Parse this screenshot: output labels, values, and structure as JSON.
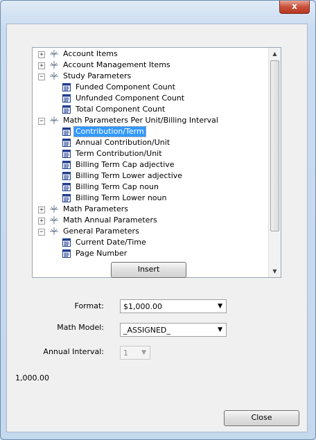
{
  "window": {
    "close_glyph": "x"
  },
  "tree": {
    "rows": [
      {
        "label": "Account Items",
        "kind": "group",
        "expander": "+"
      },
      {
        "label": "Account Management Items",
        "kind": "group",
        "expander": "+"
      },
      {
        "label": "Study Parameters",
        "kind": "group",
        "expander": "−"
      },
      {
        "label": "Funded Component Count",
        "kind": "item"
      },
      {
        "label": "Unfunded Component Count",
        "kind": "item"
      },
      {
        "label": "Total Component Count",
        "kind": "item"
      },
      {
        "label": "Math Parameters Per Unit/Billing Interval",
        "kind": "group",
        "expander": "−"
      },
      {
        "label": "Contribution/Term",
        "kind": "item",
        "selected": true
      },
      {
        "label": "Annual Contribution/Unit",
        "kind": "item"
      },
      {
        "label": "Term Contribution/Unit",
        "kind": "item"
      },
      {
        "label": "Billing Term Cap adjective",
        "kind": "item"
      },
      {
        "label": "Billing Term Lower adjective",
        "kind": "item"
      },
      {
        "label": "Billing Term Cap noun",
        "kind": "item"
      },
      {
        "label": "Billing Term Lower noun",
        "kind": "item"
      },
      {
        "label": "Math Parameters",
        "kind": "group",
        "expander": "+"
      },
      {
        "label": "Math Annual Parameters",
        "kind": "group",
        "expander": "+"
      },
      {
        "label": "General Parameters",
        "kind": "group",
        "expander": "−"
      },
      {
        "label": "Current Date/Time",
        "kind": "item"
      },
      {
        "label": "Page Number",
        "kind": "item"
      }
    ],
    "scroll_up": "▲",
    "scroll_down": "▼"
  },
  "insert_button": {
    "label": "Insert"
  },
  "form": {
    "format": {
      "label": "Format:",
      "value": "$1,000.00"
    },
    "math_model": {
      "label": "Math Model:",
      "value": "_ASSIGNED_"
    },
    "annual_interval": {
      "label": "Annual Interval:",
      "value": "1",
      "disabled": true
    }
  },
  "preview_value": "1,000.00",
  "close_button": {
    "label": "Close"
  },
  "icons": {
    "group": "parameter-group-icon",
    "item": "parameter-item-icon",
    "dropdown": "chevron-down-icon"
  },
  "colors": {
    "selection": "#3399ff",
    "item_icon": "#1f3f8f",
    "window_close": "#c8503a"
  }
}
